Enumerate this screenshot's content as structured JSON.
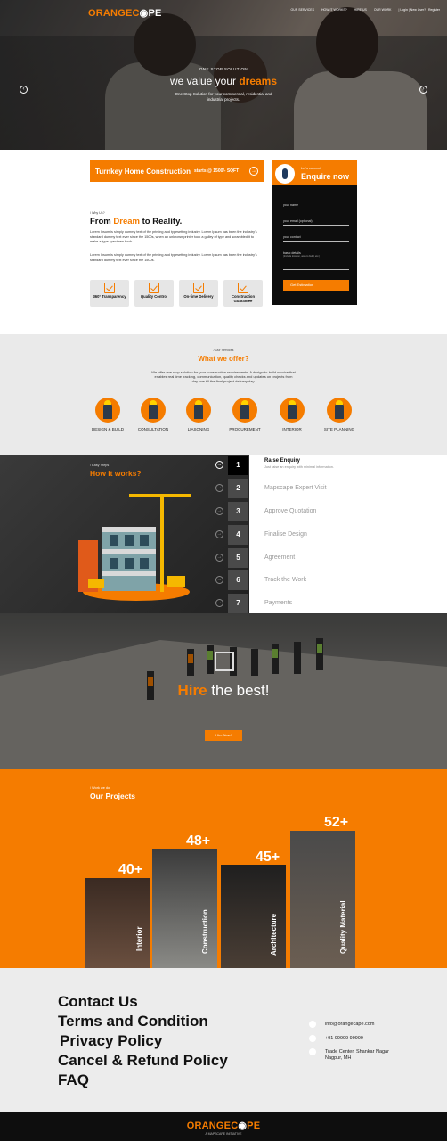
{
  "brand": {
    "part1": "ORANGEC",
    "part2": "PE",
    "tagline": "A MAPSCAPE INITIATIVE"
  },
  "nav": {
    "items": [
      "OUR SERVICES",
      "HOW IT WORKS?",
      "HIRE US",
      "OUR WORK",
      "| Login | New User? | Register"
    ]
  },
  "hero": {
    "kicker": "ONE STOP SOLUTION",
    "heading_pre": "we value your ",
    "heading_hl": "dreams",
    "sub": "One Stop Solution for your commercial, residential and industrial projects.",
    "prev_icon": "chevron-left-icon",
    "next_icon": "chevron-right-icon"
  },
  "turnkey": {
    "title": "Turnkey Home Construction",
    "price": "starts @ 1500/- SQFT",
    "icon": "arrow-right-icon"
  },
  "enquire": {
    "kicker": "Let's connect",
    "title": "Enquire now",
    "fields": [
      "your name",
      "your email (optional)",
      "your contact",
      "basic details"
    ],
    "details_hint": "(Include location, area to build, etc.)",
    "submit": "Get Estimation"
  },
  "about": {
    "tag": "/ Why Us?",
    "heading_pre": "From ",
    "heading_hl": "Dream",
    "heading_post": " to Reality.",
    "para1": "Lorem Ipsum is simply dummy text of the printing and typesetting industry. Lorem Ipsum has been the industry's standard dummy text ever since the 1500s, when an unknown printer took a galley of type and scrambled it to make a type specimen book.",
    "para2": "Lorem Ipsum is simply dummy text of the printing and typesetting industry. Lorem Ipsum has been the industry's standard dummy text ever since the 1500s.",
    "features": [
      "360° Transparency",
      "Quality Control",
      "On-time Delivery",
      "Construction Guarantee"
    ]
  },
  "services": {
    "tag": "/ Our Services",
    "title": "What we offer?",
    "desc": "We offer one stop solution for your construction requirements. A design-to-build service that enables real time tracking, communication, quality checks and updates on projects from day one till the final project delivery day.",
    "items": [
      "DESIGN & BUILD",
      "CONSULTATION",
      "LIASONING",
      "PROCUREMENT",
      "INTERIOR",
      "SITE PLANNING"
    ]
  },
  "how": {
    "tag": "/ Easy Steps",
    "title": "How it works?",
    "steps": [
      {
        "num": "1",
        "label": "Raise Enquiry",
        "sub": "Just raise an enquiry with minimal information."
      },
      {
        "num": "2",
        "label": "Mapscape Expert Visit"
      },
      {
        "num": "3",
        "label": "Approve Quotation"
      },
      {
        "num": "4",
        "label": "Finalise Design"
      },
      {
        "num": "5",
        "label": "Agreement"
      },
      {
        "num": "6",
        "label": "Track the Work"
      },
      {
        "num": "7",
        "label": "Payments"
      }
    ]
  },
  "hire": {
    "hl": "Hire",
    "rest": " the best!",
    "button": "Hire Now!"
  },
  "projects": {
    "tag": "/ Work we do",
    "title": "Our Projects",
    "items": [
      {
        "count": "40+",
        "label": "Interior"
      },
      {
        "count": "48+",
        "label": "Construction"
      },
      {
        "count": "45+",
        "label": "Architecture"
      },
      {
        "count": "52+",
        "label": "Quality Material"
      }
    ]
  },
  "contact": {
    "links": [
      "Contact Us",
      "Terms and Condition",
      "Privacy Policy",
      "Cancel & Refund Policy",
      "FAQ"
    ],
    "email": "info@orangecape.com",
    "phone": "+91 99999 99999",
    "address1": "Trade Center, Shankar Nagar",
    "address2": "Nagpur, MH"
  },
  "colors": {
    "accent": "#f57c00",
    "dark": "#0d0d0d",
    "light": "#eaeaea"
  }
}
